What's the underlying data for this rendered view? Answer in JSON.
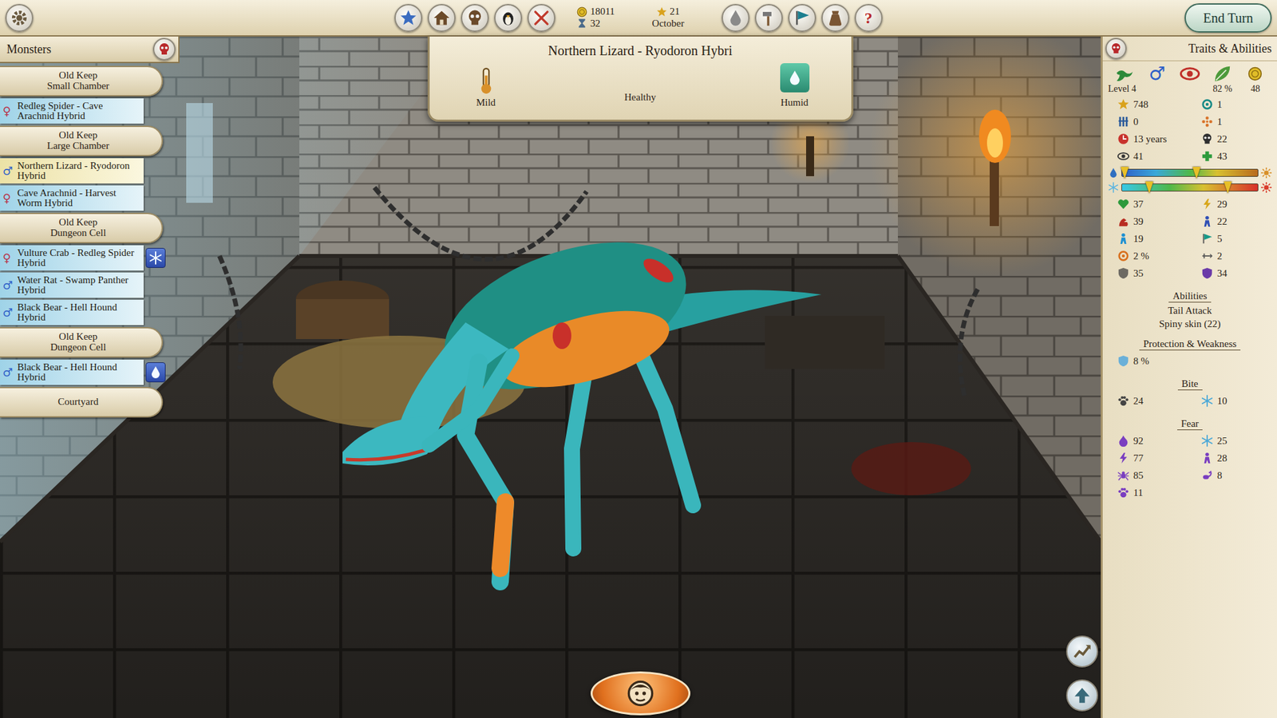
{
  "top_bar": {
    "gold": "18011",
    "turns": "32",
    "fame": "21",
    "month": "October",
    "help": "?",
    "end_turn": "End Turn"
  },
  "monsters_panel": {
    "title": "Monsters",
    "items": [
      {
        "kind": "location",
        "lines": [
          "Old Keep",
          "Small Chamber"
        ],
        "selected": false
      },
      {
        "kind": "monster",
        "label": "Redleg Spider - Cave Arachnid Hybrid",
        "gender": "♀",
        "color": "#b8324a",
        "selected": false,
        "badge": "none"
      },
      {
        "kind": "location",
        "lines": [
          "Old Keep",
          "Large Chamber"
        ],
        "selected": false
      },
      {
        "kind": "monster",
        "label": "Northern Lizard - Ryodoron Hybrid",
        "gender": "♂",
        "color": "#2f5fc8",
        "selected": true,
        "badge": "none"
      },
      {
        "kind": "monster",
        "label": "Cave Arachnid - Harvest Worm Hybrid",
        "gender": "♀",
        "color": "#b8324a",
        "selected": false,
        "badge": "none"
      },
      {
        "kind": "location",
        "lines": [
          "Old Keep",
          "Dungeon Cell"
        ],
        "selected": false
      },
      {
        "kind": "monster",
        "label": "Vulture Crab - Redleg Spider Hybrid",
        "gender": "♀",
        "color": "#b8324a",
        "selected": false,
        "badge": "cold"
      },
      {
        "kind": "monster",
        "label": "Water Rat - Swamp Panther Hybrid",
        "gender": "♂",
        "color": "#2f5fc8",
        "selected": false,
        "badge": "none"
      },
      {
        "kind": "monster",
        "label": "Black Bear - Hell Hound Hybrid",
        "gender": "♂",
        "color": "#2f5fc8",
        "selected": false,
        "badge": "none"
      },
      {
        "kind": "location",
        "lines": [
          "Old Keep",
          "Dungeon Cell"
        ],
        "selected": false
      },
      {
        "kind": "monster",
        "label": "Black Bear - Hell Hound Hybrid",
        "gender": "♂",
        "color": "#2f5fc8",
        "selected": false,
        "badge": "humid"
      },
      {
        "kind": "location",
        "lines": [
          "Courtyard"
        ],
        "selected": false
      }
    ]
  },
  "banner": {
    "title": "Northern Lizard - Ryodoron Hybri",
    "temperature": "Mild",
    "health": "Healthy",
    "humidity": "Humid"
  },
  "traits": {
    "title": "Traits & Abilities",
    "gender": "♂",
    "level": "Level 4",
    "fertility": "82 %",
    "worth": "48",
    "stats_top": [
      {
        "kind": "star",
        "value": "748"
      },
      {
        "kind": "swirl",
        "value": "1"
      },
      {
        "kind": "bars",
        "value": "0"
      },
      {
        "kind": "dots",
        "value": "1"
      },
      {
        "kind": "clock",
        "value": "13 years"
      },
      {
        "kind": "skull",
        "value": "22"
      },
      {
        "kind": "eye",
        "value": "41"
      },
      {
        "kind": "cross",
        "value": "43"
      }
    ],
    "gauges": [
      {
        "kind": "humidity",
        "low": 0.02,
        "high": 0.55
      },
      {
        "kind": "temperature",
        "low": 0.2,
        "high": 0.78
      }
    ],
    "stats": [
      {
        "kind": "heart",
        "value": "37"
      },
      {
        "kind": "bolt",
        "value": "29"
      },
      {
        "kind": "arm",
        "value": "39"
      },
      {
        "kind": "figure",
        "value": "22"
      },
      {
        "kind": "runner",
        "value": "19"
      },
      {
        "kind": "flag",
        "value": "5"
      },
      {
        "kind": "target",
        "value": "2 %"
      },
      {
        "kind": "sword",
        "value": "2"
      },
      {
        "kind": "shield",
        "value": "35"
      },
      {
        "kind": "ward",
        "value": "34"
      }
    ],
    "sections": [
      {
        "kind": "lines",
        "title": "Abilities",
        "items": [
          "Tail Attack",
          "Spiny skin (22)"
        ]
      },
      {
        "kind": "grid",
        "title": "Protection & Weakness",
        "items": [
          {
            "kind": "protect",
            "value": "8 %"
          }
        ]
      },
      {
        "kind": "grid",
        "title": "Bite",
        "items": [
          {
            "kind": "claw",
            "value": "24"
          },
          {
            "kind": "frost",
            "value": "10"
          }
        ]
      },
      {
        "kind": "grid",
        "title": "Fear",
        "items": [
          {
            "kind": "flame",
            "value": "92"
          },
          {
            "kind": "frost",
            "value": "25"
          },
          {
            "kind": "spark",
            "value": "77"
          },
          {
            "kind": "ghost",
            "value": "28"
          },
          {
            "kind": "spider",
            "value": "85"
          },
          {
            "kind": "scorpion",
            "value": "8"
          },
          {
            "kind": "paw",
            "value": "11"
          }
        ]
      }
    ]
  }
}
